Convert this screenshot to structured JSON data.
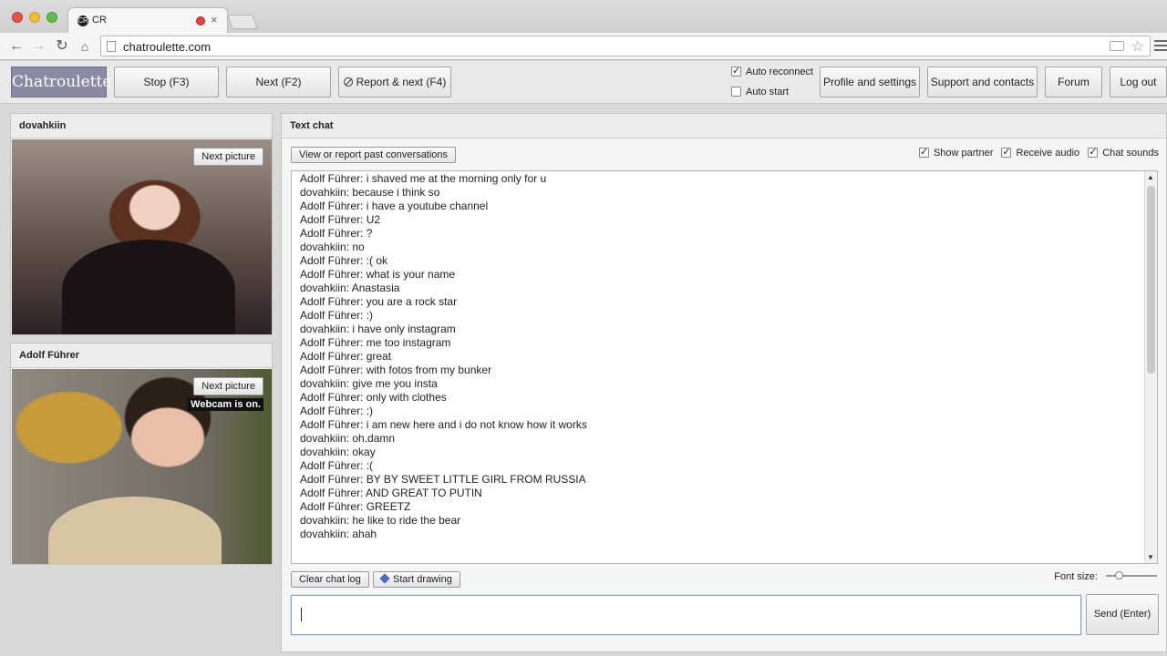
{
  "browser": {
    "tab_title": "CR",
    "tab_favicon_text": "CR",
    "tab_close": "×",
    "url": "chatroulette.com"
  },
  "icons": {
    "back": "back-arrow-icon",
    "forward": "forward-arrow-icon",
    "reload": "reload-icon",
    "home": "home-icon",
    "star": "bookmark-star-icon"
  },
  "header": {
    "logo": "Chatroulette",
    "stop": "Stop (F3)",
    "next": "Next (F2)",
    "report_next": "Report & next (F4)",
    "auto_reconnect": "Auto reconnect",
    "auto_start": "Auto start",
    "profile": "Profile and settings",
    "support": "Support and contacts",
    "forum": "Forum",
    "logout": "Log out"
  },
  "panels": {
    "self_name": "dovahkiin",
    "partner_name": "Adolf Führer",
    "next_picture": "Next picture",
    "webcam_status": "Webcam is on."
  },
  "chat": {
    "title": "Text chat",
    "view_report": "View or report past conversations",
    "show_partner": "Show partner",
    "receive_audio": "Receive audio",
    "chat_sounds": "Chat sounds",
    "messages": [
      "Adolf Führer: i shaved me at the morning only for u",
      "dovahkiin: because i think so",
      "Adolf Führer: i have a youtube channel",
      "Adolf Führer: U2",
      "Adolf Führer: ?",
      "dovahkiin: no",
      "Adolf Führer: :( ok",
      "Adolf Führer: what is your name",
      "dovahkiin: Anastasia",
      "Adolf Führer: you are a rock star",
      "Adolf Führer: :)",
      "dovahkiin: i have only instagram",
      "Adolf Führer: me too instagram",
      "Adolf Führer: great",
      "Adolf Führer: with fotos from my bunker",
      "dovahkiin: give me you insta",
      "Adolf Führer: only with clothes",
      "Adolf Führer: :)",
      "Adolf Führer: i am new here and i do not know how it works",
      "dovahkiin: oh.damn",
      "dovahkiin: okay",
      "Adolf Führer: :(",
      "Adolf Führer: BY BY SWEET LITTLE GIRL FROM RUSSIA",
      "Adolf Führer: AND GREAT TO PUTIN",
      "Adolf Führer: GREETZ",
      "dovahkiin: he like to ride the bear",
      "dovahkiin: ahah"
    ],
    "clear_log": "Clear chat log",
    "start_drawing": "Start drawing",
    "font_size": "Font size:",
    "send": "Send (Enter)"
  }
}
